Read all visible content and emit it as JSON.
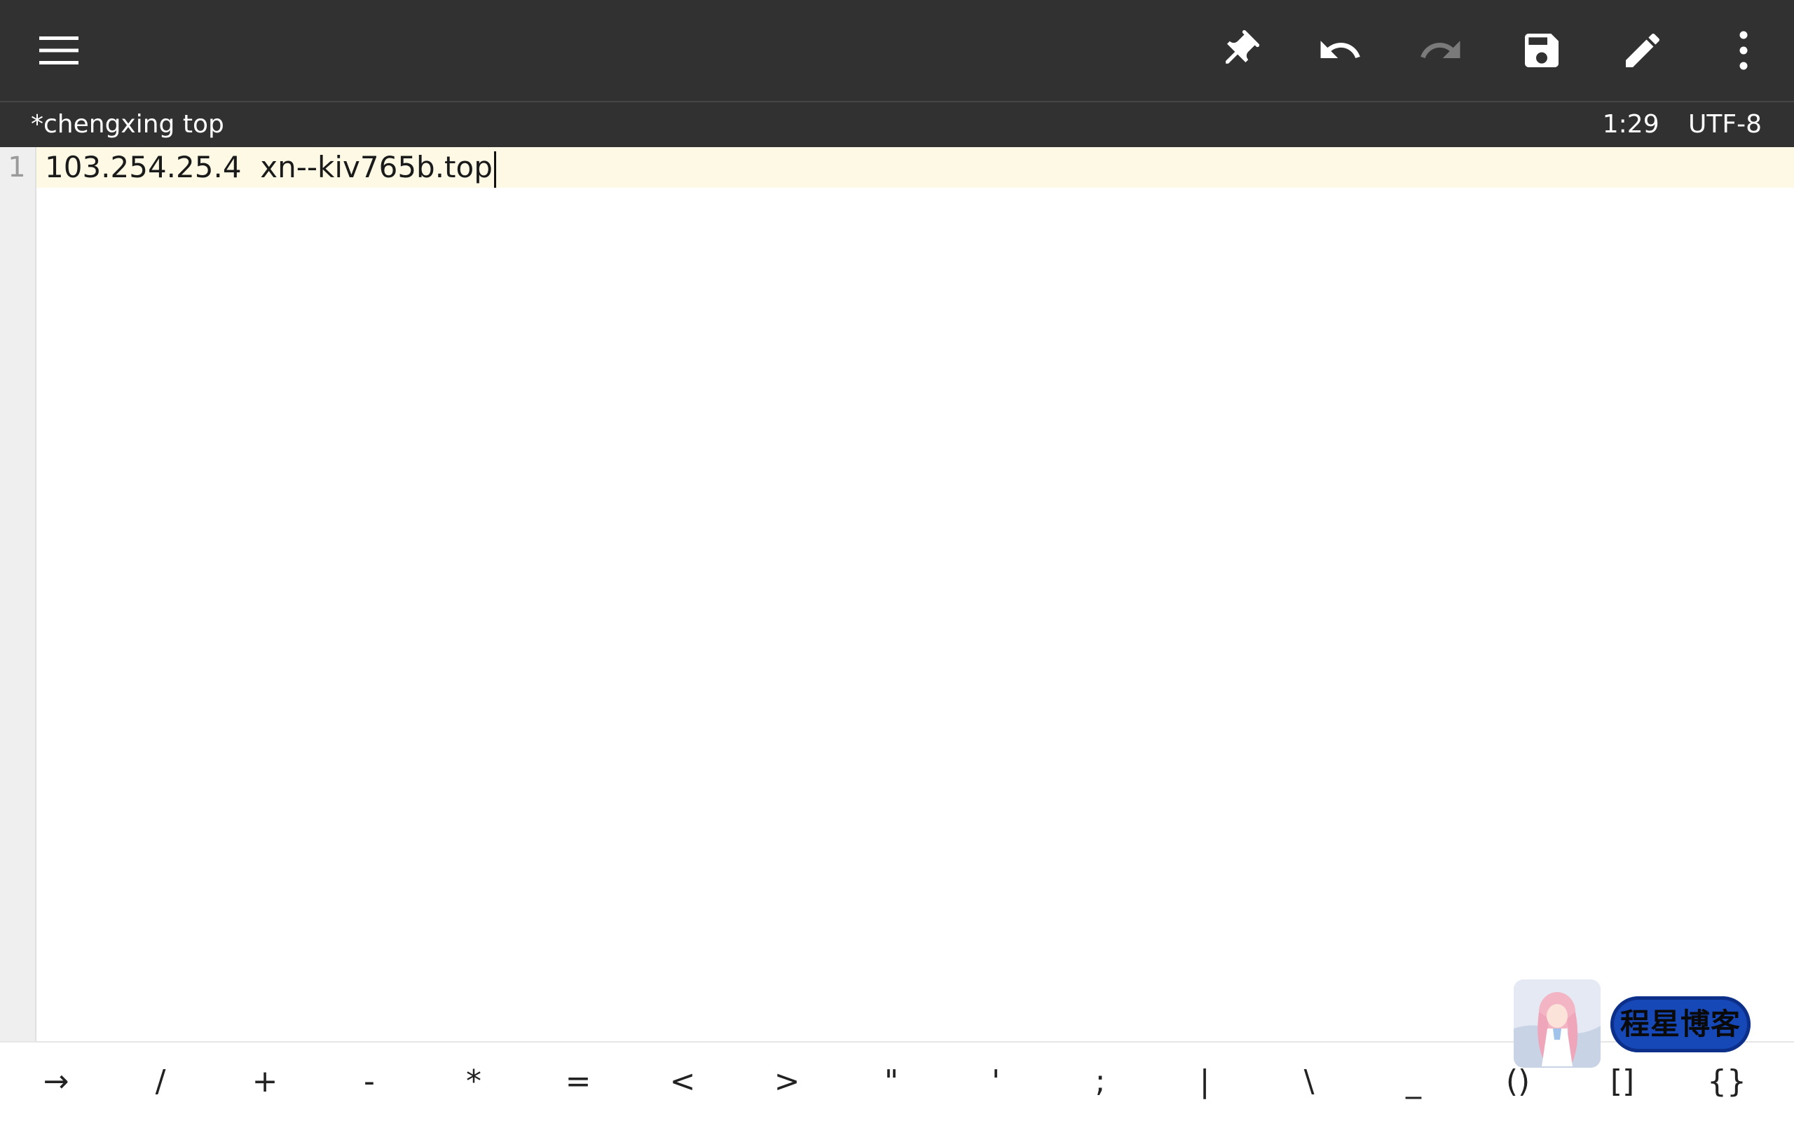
{
  "toolbar": {
    "icons": {
      "menu": "menu-icon",
      "pin": "pin-icon",
      "undo": "undo-icon",
      "redo": "redo-icon",
      "save": "save-icon",
      "edit": "edit-icon",
      "more": "more-vert-icon"
    },
    "colors": {
      "background": "#313131",
      "icon_active": "#ffffff",
      "icon_disabled": "#7a7a7a"
    }
  },
  "status": {
    "filename": "*chengxing top",
    "cursor_position": "1:29",
    "encoding": "UTF-8"
  },
  "editor": {
    "lines": [
      {
        "number": "1",
        "text": "103.254.25.4  xn--kiv765b.top"
      }
    ],
    "colors": {
      "current_line": "#fdf9e4",
      "gutter": "#efefef"
    }
  },
  "symbols": [
    "→",
    "/",
    "+",
    "-",
    "*",
    "=",
    "<",
    ">",
    "\"",
    "'",
    ";",
    "|",
    "\\",
    "_",
    "()",
    "[]",
    "{}"
  ],
  "watermark": {
    "text": "程星博客",
    "badge_color": "#1748b8"
  }
}
